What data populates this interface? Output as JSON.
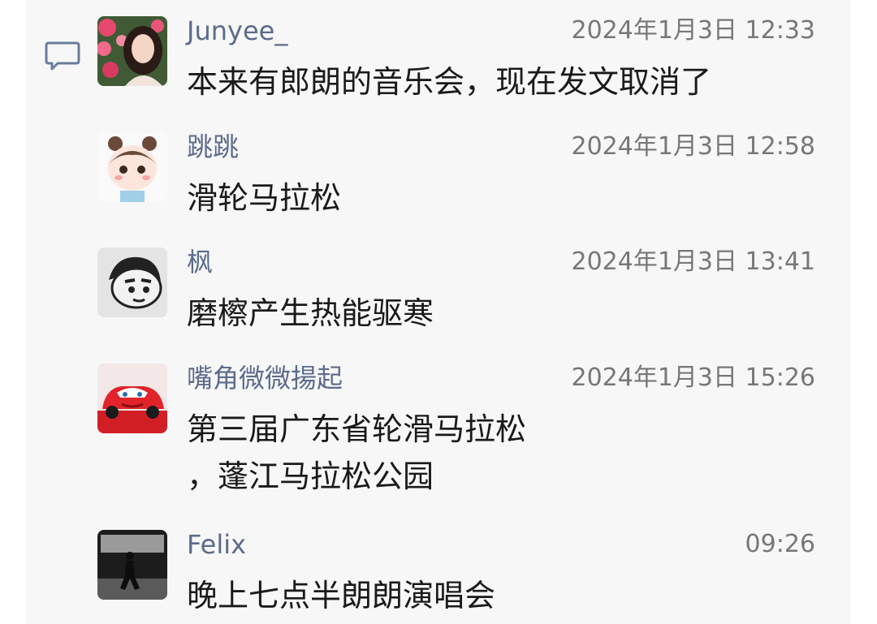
{
  "comments": [
    {
      "name": "Junyee_",
      "time": "2024年1月3日 12:33",
      "text_lines": [
        "本来有郎朗的音乐会，现在发文取消了"
      ],
      "avatar": "girl-with-flowers-photo"
    },
    {
      "name": "跳跳",
      "time": "2024年1月3日 12:58",
      "text_lines": [
        "滑轮马拉松"
      ],
      "avatar": "cartoon-girl-illustration"
    },
    {
      "name": "枫",
      "time": "2024年1月3日 13:41",
      "text_lines": [
        "磨檫产生热能驱寒"
      ],
      "avatar": "cartoon-boy-sketch"
    },
    {
      "name": "嘴角微微揚起",
      "time": "2024年1月3日 15:26",
      "text_lines": [
        "第三届广东省轮滑马拉松",
        "，蓬江马拉松公园"
      ],
      "avatar": "red-race-car"
    },
    {
      "name": "Felix",
      "time": "09:26",
      "text_lines": [
        "晚上七点半朗朗演唱会"
      ],
      "avatar": "silhouette-walking-photo"
    }
  ],
  "colors": {
    "panel_background": "#f7f7f7",
    "name": "#5b6b8c",
    "time": "#777777",
    "text": "#1a1a1a",
    "icon_stroke": "#6a7c9b"
  },
  "icons": {
    "comment": "comment-bubble-icon"
  }
}
